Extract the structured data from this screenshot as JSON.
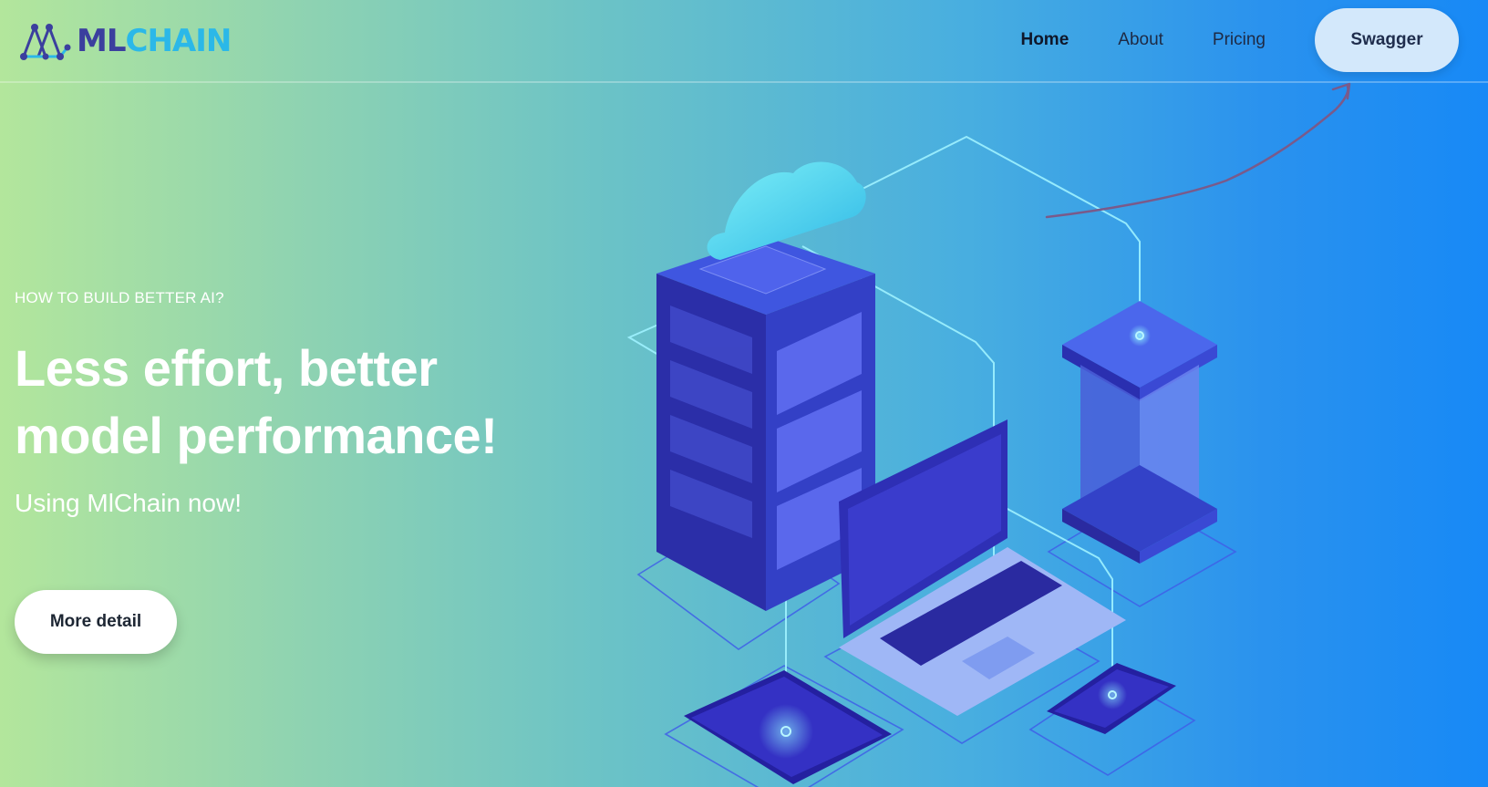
{
  "header": {
    "logo": {
      "part1": "ML",
      "part2": "CHAIN",
      "icon": "network-triangle-logo"
    },
    "nav": [
      {
        "label": "Home",
        "active": true
      },
      {
        "label": "About",
        "active": false
      },
      {
        "label": "Pricing",
        "active": false
      }
    ],
    "swagger_label": "Swagger"
  },
  "hero": {
    "eyebrow": "HOW TO BUILD BETTER AI?",
    "headline_line1": "Less effort, better",
    "headline_line2": "model performance!",
    "subline": "Using MlChain now!",
    "cta_label": "More detail"
  },
  "colors": {
    "gradient_start": "#b3e69c",
    "gradient_end": "#1789f6",
    "swagger_bg": "#d3e8fb",
    "logo_ml": "#3b3f9e",
    "logo_chain": "#2bb8e8",
    "annotation_arrow": "#7a5a8a"
  },
  "illustration": {
    "icons": [
      "cloud-icon",
      "server-rack-icon",
      "laptop-icon",
      "tablet-icon",
      "phone-icon",
      "gpu-tower-icon"
    ]
  }
}
